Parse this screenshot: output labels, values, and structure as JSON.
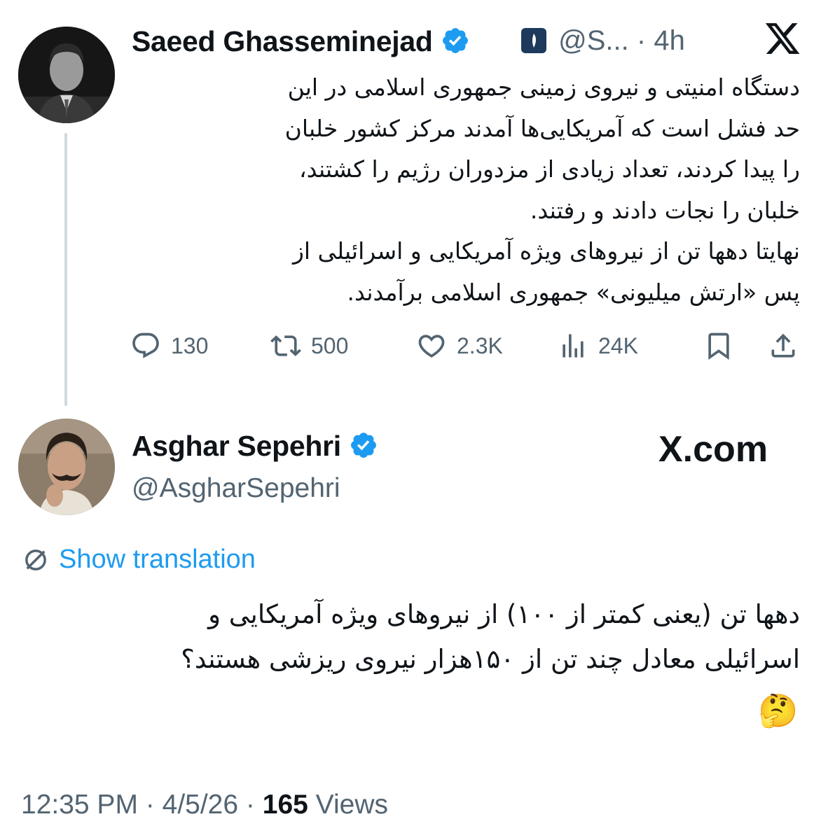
{
  "quoted_tweet": {
    "author_name": "Saeed Ghasseminejad",
    "handle_truncated": "@S...",
    "time_separator": "·",
    "time_ago": "4h",
    "text": "دستگاه امنیتی و نیروی زمینی جمهوری اسلامی در این\nحد فشل است که آمریکایی‌ها آمدند مرکز کشور خلبان\nرا پیدا کردند، تعداد زیادی از مزدوران رژیم را کشتند،\nخلبان را نجات دادند و رفتند.\nنهایتا دهها تن از نیروهای ویژه آمریکایی و اسرائیلی از\nپس «ارتش میلیونی» جمهوری اسلامی برآمدند.",
    "stats": {
      "replies": "130",
      "retweets": "500",
      "likes": "2.3K",
      "views": "24K"
    },
    "icons": [
      "verified-badge",
      "affiliation-badge",
      "x-logo",
      "reply-icon",
      "retweet-icon",
      "like-icon",
      "views-icon",
      "bookmark-icon",
      "share-icon"
    ]
  },
  "main_tweet": {
    "author_name": "Asghar Sepehri",
    "handle": "@AsgharSepehri",
    "watermark": "X.com",
    "show_translation": "Show translation",
    "text": "دهها تن (یعنی کمتر از ۱۰۰) از نیروهای ویژه آمریکایی و\nاسرائیلی معادل چند تن از ۱۵۰هزار نیروی ریزشی هستند؟",
    "emoji": "🤔",
    "footer": {
      "time": "12:35 PM",
      "separator": "·",
      "date": "4/5/26",
      "views_count": "165",
      "views_label": "Views"
    }
  },
  "colors": {
    "verified_blue": "#1d9bf0",
    "secondary_text": "#536471",
    "primary_text": "#0f1419",
    "thread_line": "#cfd9de"
  }
}
